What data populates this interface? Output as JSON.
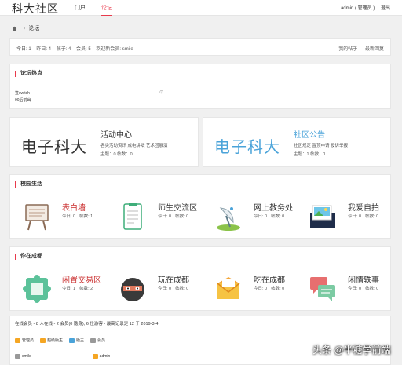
{
  "header": {
    "logo": "科大社区",
    "nav": [
      {
        "label": "门户"
      },
      {
        "label": "论坛"
      }
    ],
    "user": "admin ( 管理员 )",
    "user_menu": "退出"
  },
  "breadcrumb": {
    "current": "论坛"
  },
  "stats": {
    "today": "今日: 1",
    "yesterday": "昨日: 4",
    "posts": "帖子: 4",
    "members": "会员: 5",
    "welcome": "欢迎新会员: smile",
    "my_posts": "我的帖子",
    "latest": "最新回复"
  },
  "hot": {
    "title": "论坛热点",
    "item1": "签switch",
    "item2": "90后前出",
    "mark": "⊙"
  },
  "portals": [
    {
      "brand": "电子科大",
      "title": "活动中心",
      "desc": "各类活动资讯 成电讲坛 艺术团展演",
      "stats": "主题：0    帖数：0"
    },
    {
      "brand": "电子科大",
      "title": "社区公告",
      "desc": "社区规定 置顶申请 投诉举报",
      "stats": "主题：1    帖数：1"
    }
  ],
  "campus": {
    "title": "校园生活",
    "forums": [
      {
        "name": "表白墙",
        "today": "今日: 0",
        "posts": "帖数: 1"
      },
      {
        "name": "师生交流区",
        "today": "今日: 0",
        "posts": "帖数: 0"
      },
      {
        "name": "网上教务处",
        "today": "今日: 0",
        "posts": "帖数: 0"
      },
      {
        "name": "我爱自拍",
        "today": "今日: 0",
        "posts": "帖数: 0"
      }
    ]
  },
  "chengdu": {
    "title": "你在成都",
    "forums": [
      {
        "name": "闲置交易区",
        "today": "今日: 1",
        "posts": "帖数: 2"
      },
      {
        "name": "玩在成都",
        "today": "今日: 0",
        "posts": "帖数: 0"
      },
      {
        "name": "吃在成都",
        "today": "今日: 0",
        "posts": "帖数: 0"
      },
      {
        "name": "闲情轶事",
        "today": "今日: 0",
        "posts": "帖数: 0"
      }
    ]
  },
  "online": {
    "title": "在线会员 - 8 人在线 - 2 会员(0 隐身), 6 位游客 - 最高记录是 12 于 2019-3-4.",
    "legend": [
      "管理员",
      "超级版主",
      "版主",
      "会员"
    ],
    "users": [
      "smile",
      "admin"
    ]
  },
  "watermark": "头条 @半糖学前端",
  "colors": {
    "accent": "#e83a4c",
    "blue": "#4aa3d9"
  }
}
